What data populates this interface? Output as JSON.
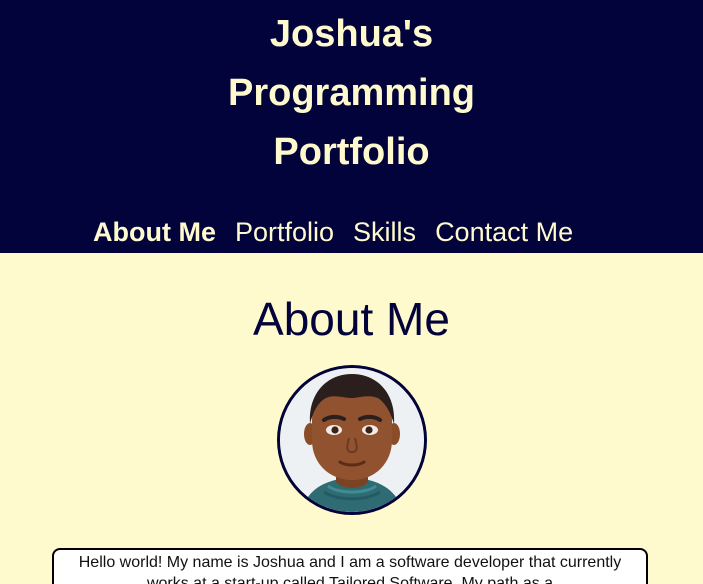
{
  "header": {
    "title_lines": [
      "Joshua's",
      "Programming",
      "Portfolio"
    ],
    "nav": [
      {
        "label": "About Me",
        "active": true
      },
      {
        "label": "Portfolio",
        "active": false
      },
      {
        "label": "Skills",
        "active": false
      },
      {
        "label": "Contact Me",
        "active": false
      }
    ]
  },
  "about": {
    "heading": "About Me",
    "avatar_icon": "avatar-portrait-icon",
    "bio": "Hello world! My name is Joshua and I am a software developer that currently works at a start-up called Tailored Software. My path as a"
  },
  "colors": {
    "header_bg": "#02033b",
    "page_bg": "#fffacd",
    "accent_text": "#fffacd",
    "heading_text": "#02033b"
  }
}
